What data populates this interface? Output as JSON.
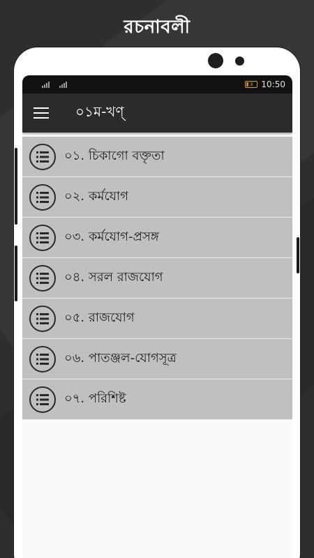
{
  "promo": {
    "title": "রচনাবলী"
  },
  "status_bar": {
    "battery_level": "3",
    "time": "10:50"
  },
  "app_bar": {
    "title": "০১ম-খণ্"
  },
  "chapters": [
    {
      "label": "০১. চিকাগো বক্তৃতা"
    },
    {
      "label": "০২. কর্মযোগ"
    },
    {
      "label": "০৩. কর্মযোগ-প্রসঙ্গ"
    },
    {
      "label": "০৪. সরল রাজযোগ"
    },
    {
      "label": "০৫. রাজযোগ"
    },
    {
      "label": "০৬. পাতঞ্জল-যোগসূত্র"
    },
    {
      "label": "০৭. পরিশিষ্ট"
    }
  ],
  "icons": {
    "menu": "hamburger-menu-icon",
    "chapter": "list-icon"
  },
  "colors": {
    "app_bar": "#2b2b2b",
    "list_item": "#c0c0c0",
    "background": "#2e2e2e"
  }
}
